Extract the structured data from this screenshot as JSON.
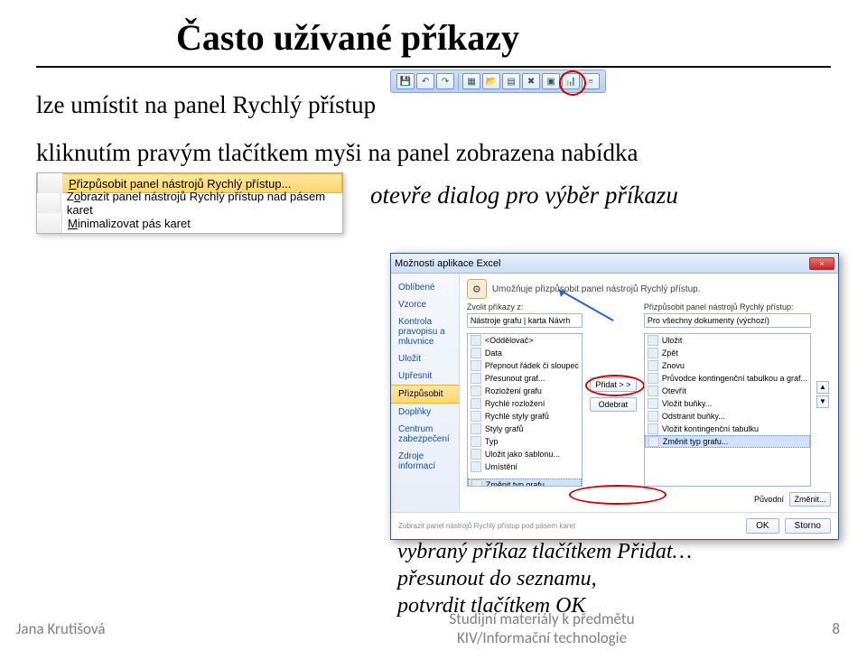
{
  "title": "Často užívané příkazy",
  "line1": "lze umístit na panel Rychlý přístup",
  "line2": "kliknutím pravým tlačítkem myši na panel zobrazena nabídka",
  "line3": "otevře dialog pro výběr příkazu",
  "caption1": "vybraný příkaz tlačítkem Přidat…",
  "caption2": "přesunout do seznamu,",
  "caption3": "potvrdit tlačítkem OK",
  "qat_icons": [
    "save",
    "undo",
    "redo",
    "sep",
    "grid",
    "open",
    "sheet",
    "clear",
    "pivot",
    "chart",
    "more"
  ],
  "context_menu": {
    "items": [
      {
        "label_pre": "",
        "u": "P",
        "label_post": "řizpůsobit panel nástrojů Rychlý přístup...",
        "selected": true
      },
      {
        "label_pre": "Z",
        "u": "o",
        "label_post": "brazit panel nástrojů Rychlý přístup nad pásem karet",
        "selected": false
      },
      {
        "label_pre": "",
        "u": "M",
        "label_post": "inimalizovat pás karet",
        "selected": false
      }
    ]
  },
  "dialog": {
    "title": "Možnosti aplikace Excel",
    "close": "×",
    "side": [
      "Oblíbené",
      "Vzorce",
      "Kontrola pravopisu a mluvnice",
      "Uložit",
      "Upřesnit",
      "Přizpůsobit",
      "Doplňky",
      "Centrum zabezpečení",
      "Zdroje informací"
    ],
    "side_selected": "Přizpůsobit",
    "head": "Umožňuje přizpůsobit panel nástrojů Rychlý přístup.",
    "left_label": "Zvolit příkazy z:",
    "left_select": "Nástroje grafu | karta Návrh",
    "right_label": "Přizpůsobit panel nástrojů Rychlý přístup:",
    "right_select": "Pro všechny dokumenty (výchozí)",
    "left_list": [
      "<Oddělovač>",
      "Data",
      "Přepnout řádek či sloupec",
      "Přesunout graf...",
      "Rozložení grafu",
      "Rychlé rozložení",
      "Rychlé styly grafů",
      "Styly grafů",
      "Typ",
      "Uložit jako šablonu...",
      "Umístění",
      "",
      "Změnit typ grafu..."
    ],
    "left_selected": "Změnit typ grafu...",
    "right_list": [
      "Uložit",
      "Zpět",
      "Znovu",
      "Průvodce kontingenční tabulkou a graf...",
      "Otevřít",
      "Vložit buňky...",
      "Odstranit buňky...",
      "Vložit kontingenční tabulku",
      "Změnit typ grafu..."
    ],
    "right_selected": "Změnit typ grafu...",
    "btn_add": "Přidat > >",
    "btn_remove": "Odebrat",
    "btn_reset_label": "Původní",
    "btn_reset": "Změnit...",
    "footer_note": "Zobrazit panel nástrojů Rychlý přístup pod pásem karet",
    "btn_ok": "OK",
    "btn_cancel": "Storno"
  },
  "footer": {
    "author": "Jana Krutišová",
    "center1": "Studijní materiály k předmětu",
    "center2": "KIV/Informační technologie",
    "page": "8"
  }
}
